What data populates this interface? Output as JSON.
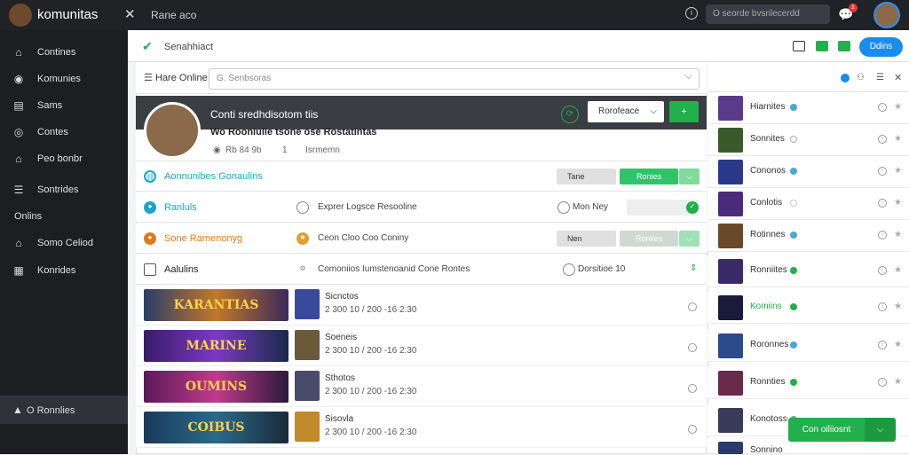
{
  "topbar": {
    "brand": "komunitas",
    "title": "Rane aco",
    "search_placeholder": "O seorde bvsrilecerdd",
    "notif_count": "1"
  },
  "sidebar": {
    "items": [
      {
        "label": "Contines",
        "icon": "home-icon"
      },
      {
        "label": "Komunies",
        "icon": "globe-icon"
      },
      {
        "label": "Sams",
        "icon": "book-icon"
      },
      {
        "label": "Contes",
        "icon": "chat-icon"
      },
      {
        "label": "Peo bonbr",
        "icon": "house-icon"
      },
      {
        "label": "Sontrides",
        "icon": "menu-icon"
      },
      {
        "label": "Onlins",
        "icon": ""
      },
      {
        "label": "Somo Celiod",
        "icon": "home-icon"
      },
      {
        "label": "Konrides",
        "icon": "calendar-icon"
      }
    ],
    "footer": "O Ronnlies"
  },
  "actionbar": {
    "label": "Senahhiact",
    "primary": "Ddins"
  },
  "filter": {
    "label": "Hare Online",
    "placeholder": "G. Senbsoras"
  },
  "profile": {
    "name": "Conti sredhdisotom tiis",
    "subtitle": "Wo Rooniulie tsone ose Rostatintas",
    "stat1": "S",
    "stat2": "Rb 84 9b",
    "stat3": "1",
    "stat4": "Isrmemn",
    "dropdown": "Rorofeace",
    "add": "+"
  },
  "rows": [
    {
      "title": "Aonnunibes Gonaulins",
      "desc": "",
      "chip": "Tane",
      "button": "Ronies",
      "accent": "#1aa6c8"
    },
    {
      "title": "Ranluls",
      "desc": "Exprer Logsce Resooline",
      "chip": "Mon Ney",
      "button": "",
      "accent": "#1aa6c8"
    },
    {
      "title": "Sone Ramenonyg",
      "desc": "Ceon Cloo Coo Coniny",
      "chip": "Nen",
      "button": "Ronlies",
      "accent": "#e07b1a"
    },
    {
      "title": "Aalulins",
      "desc": "Comoniios Iumstenoanid Cone Rontes",
      "chip": "Dorsitioe 10",
      "button": "",
      "accent": "#555555"
    }
  ],
  "games": [
    {
      "banner": "KARANTIAS",
      "name": "Sicnctos",
      "meta": "2 300 10 / 200 -16 2:30"
    },
    {
      "banner": "MARINE",
      "name": "Soeneis",
      "meta": "2 300 10 / 200 -16 2:30"
    },
    {
      "banner": "OUMINS",
      "name": "Sthotos",
      "meta": "2 300 10 / 200 -16 2:30"
    },
    {
      "banner": "COIBUS",
      "name": "Sisovla",
      "meta": "2 300 10 / 200 -16 2:30"
    }
  ],
  "right": {
    "items": [
      {
        "name": "Hiarnites",
        "status": "blue"
      },
      {
        "name": "Sonnites",
        "status": "gray"
      },
      {
        "name": "Cononos",
        "status": "blue"
      },
      {
        "name": "Conlotis",
        "status": "gray"
      },
      {
        "name": "Rotinnes",
        "status": "blue"
      },
      {
        "name": "Ronniites",
        "status": "green"
      },
      {
        "name": "Komiins",
        "status": "green"
      },
      {
        "name": "Roronnes",
        "status": "blue"
      },
      {
        "name": "Ronnties",
        "status": "green"
      },
      {
        "name": "Konotoss",
        "status": "blue"
      },
      {
        "name": "Sonnino",
        "status": "gray"
      }
    ]
  },
  "footer_button": "Con oiliiosnt",
  "colors": {
    "green": "#21b04b",
    "blue": "#1a8cf0",
    "dark": "#1c1e22"
  }
}
